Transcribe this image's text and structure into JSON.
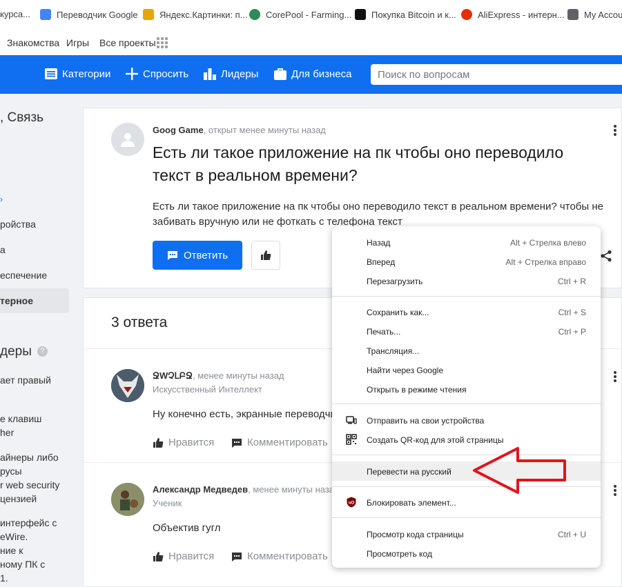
{
  "bookmarks": [
    {
      "label": "курса...",
      "color": "#f2a40c"
    },
    {
      "label": "Переводчик Google",
      "color": "#4285f4"
    },
    {
      "label": "Яндекс.Картинки: п...",
      "color": "#e6a700"
    },
    {
      "label": "CorePool - Farming...",
      "color": "#2e8b57"
    },
    {
      "label": "Покупка Bitcoin и к...",
      "color": "#111111"
    },
    {
      "label": "AliExpress - интерн...",
      "color": "#e62e04"
    },
    {
      "label": "My Accou",
      "color": "#5f6368"
    }
  ],
  "subnav": {
    "items": [
      "Знакомства",
      "Игры",
      "Все проекты"
    ]
  },
  "header": {
    "nav": [
      "Категории",
      "Спросить",
      "Лидеры",
      "Для бизнеса"
    ],
    "search_placeholder": "Поиск по вопросам",
    "bg": "#0f6ff0"
  },
  "sidebar": {
    "title": ", Связь",
    "items": [
      "ройства",
      "а",
      "еспечение",
      "терное"
    ],
    "leaders_title": "деры",
    "leaders_badge": "?",
    "leaders": [
      "ает правый",
      "е клавиш",
      "her",
      "айнеры либо",
      "русы",
      "r web security",
      "цензией",
      "интерфейс с",
      "eWire.",
      "ние к",
      "ному ПК с",
      "1."
    ]
  },
  "question": {
    "author": "Goog Game",
    "meta": ", открыт менее минуты назад",
    "title": "Есть ли такое приложение на пк чтобы оно переводило текст в реальном времени?",
    "text": "Есть ли такое приложение на пк чтобы оно переводило текст в реальном времени? чтобы не забивать вручную или не фоткать с телефона текст",
    "answer_button": "Ответить"
  },
  "answers": {
    "title": "3 ответа",
    "items": [
      {
        "name": "ՋWՉԼԲՋ",
        "meta": ", менее минуты назад",
        "role": "Искусственный Интеллект",
        "text": "Ну конечно есть, экранные переводчи",
        "like": "Нравится",
        "comment": "Комментировать"
      },
      {
        "name": "Александр Медведев",
        "meta": ", менее минуты назад",
        "role": "Ученик",
        "text": "Объектив гугл",
        "like": "Нравится",
        "comment": "Комментировать"
      }
    ]
  },
  "context_menu": {
    "groups": [
      [
        {
          "label": "Назад",
          "shortcut": "Alt + Стрелка влево"
        },
        {
          "label": "Вперед",
          "shortcut": "Alt + Стрелка вправо"
        },
        {
          "label": "Перезагрузить",
          "shortcut": "Ctrl + R"
        }
      ],
      [
        {
          "label": "Сохранить как...",
          "shortcut": "Ctrl + S"
        },
        {
          "label": "Печать...",
          "shortcut": "Ctrl + P"
        },
        {
          "label": "Трансляция...",
          "shortcut": ""
        },
        {
          "label": "Найти через Google",
          "shortcut": ""
        },
        {
          "label": "Открыть в режиме чтения",
          "shortcut": ""
        }
      ],
      [
        {
          "label": "Отправить на свои устройства",
          "shortcut": "",
          "icon": "devices-icon"
        },
        {
          "label": "Создать QR-код для этой страницы",
          "shortcut": "",
          "icon": "qr-code-icon"
        }
      ],
      [
        {
          "label": "Перевести на русский",
          "shortcut": "",
          "highlighted": true
        }
      ],
      [
        {
          "label": "Блокировать элемент...",
          "shortcut": "",
          "icon": "ublock-icon"
        }
      ],
      [
        {
          "label": "Просмотр кода страницы",
          "shortcut": "Ctrl + U"
        },
        {
          "label": "Просмотреть код",
          "shortcut": ""
        }
      ]
    ]
  },
  "annotation": {
    "arrow_color": "#e0141b"
  }
}
